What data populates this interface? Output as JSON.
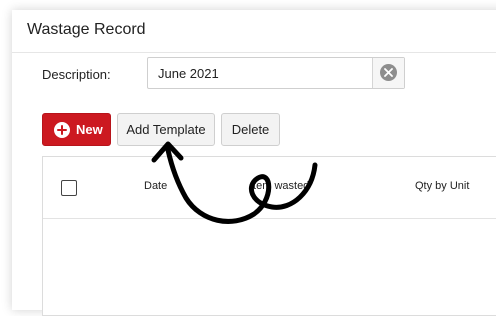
{
  "window": {
    "title": "Wastage Record"
  },
  "form": {
    "description_label": "Description:",
    "description_value": "June 2021"
  },
  "toolbar": {
    "new_label": "New",
    "add_template_label": "Add Template",
    "delete_label": "Delete"
  },
  "grid": {
    "columns": [
      "Date",
      "Item wasted",
      "Qty by Unit"
    ]
  },
  "colors": {
    "primary_button": "#cc1920",
    "annotation_stroke": "#000000"
  },
  "icons": [
    "clear-icon",
    "plus-circle-icon",
    "checkbox-icon"
  ]
}
